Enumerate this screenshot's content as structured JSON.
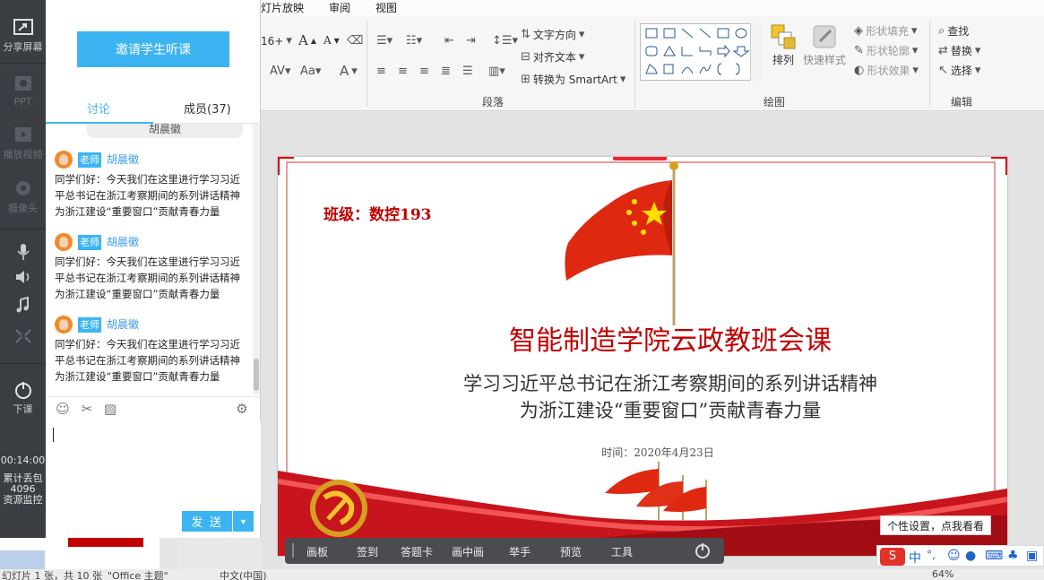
{
  "left_rail": {
    "share_screen": "分享屏幕",
    "ppt": "PPT",
    "play_video": "播放视频",
    "camera": "摄像头",
    "end_class": "下课",
    "timer": "00:14:00",
    "lost_packets": "累计丢包",
    "lost_count": "4096",
    "resource_monitor": "资源监控"
  },
  "ribbon": {
    "tabs": {
      "slideshow": "灯片放映",
      "review": "审阅",
      "view": "视图"
    },
    "font_size": "16+",
    "text_direction": "文字方向",
    "align_text": "对齐文本",
    "convert_smartart": "转换为 SmartArt",
    "paragraph_label": "段落",
    "arrange": "排列",
    "quick_styles": "快速样式",
    "shape_fill": "形状填充",
    "shape_outline": "形状轮廓",
    "shape_effects": "形状效果",
    "drawing_label": "绘图",
    "find": "查找",
    "replace": "替换",
    "select": "选择",
    "editing_label": "编辑"
  },
  "chat": {
    "invite_button": "邀请学生听课",
    "tab_discuss": "讨论",
    "tab_members": "成员(37)",
    "prev_name": "胡晨徽",
    "messages": [
      {
        "role": "老师",
        "sender": "胡晨徽",
        "text": "同学们好：今天我们在这里进行学习习近平总书记在浙江考察期间的系列讲话精神为浙江建设“重要窗口”贡献青春力量"
      },
      {
        "role": "老师",
        "sender": "胡晨徽",
        "text": "同学们好：今天我们在这里进行学习习近平总书记在浙江考察期间的系列讲话精神为浙江建设“重要窗口”贡献青春力量"
      },
      {
        "role": "老师",
        "sender": "胡晨徽",
        "text": "同学们好：今天我们在这里进行学习习近平总书记在浙江考察期间的系列讲话精神为浙江建设“重要窗口”贡献青春力量"
      }
    ],
    "send_button": "发 送",
    "input_value": ""
  },
  "slide": {
    "class_label": "班级：数控193",
    "title": "智能制造学院云政教班会课",
    "subtitle_line1": "学习习近平总书记在浙江考察期间的系列讲话精神",
    "subtitle_line2": "为浙江建设“重要窗口”贡献青春力量",
    "time": "时间：2020年4月23日"
  },
  "personal_tip": "个性设置，点我看看",
  "bottom_bar": [
    "画板",
    "签到",
    "答题卡",
    "画中画",
    "举手",
    "预览",
    "工具"
  ],
  "ime": {
    "lang": "中"
  },
  "status_bar": {
    "left": "幻灯片 1 张，共 10 张",
    "theme": "\"Office 主题\"",
    "lang": "中文(中国)",
    "zoom": "64%"
  },
  "colors": {
    "accent_blue": "#3db4f2",
    "slide_red": "#c00000",
    "rail_dark": "#3a3d42"
  }
}
